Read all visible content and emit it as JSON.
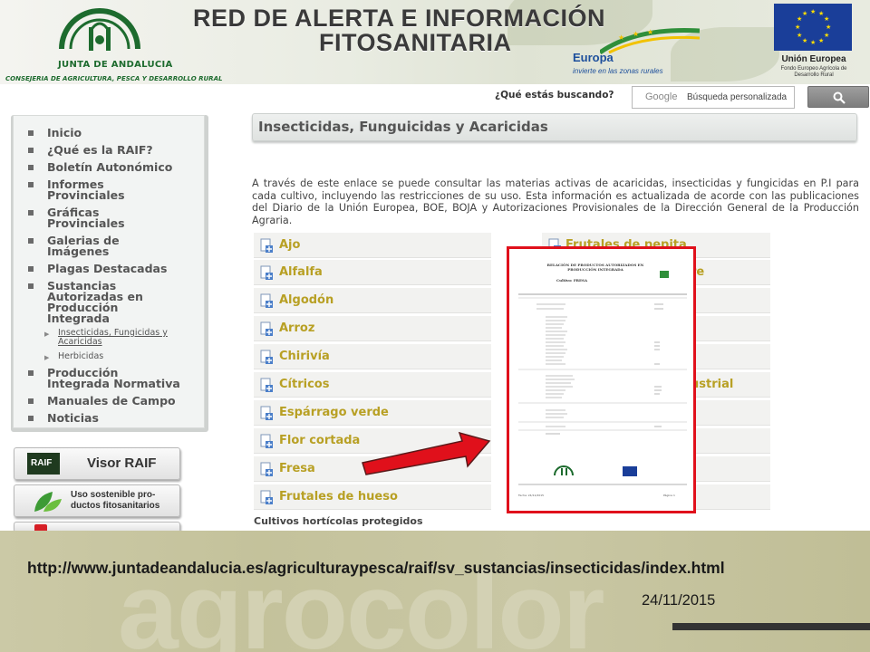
{
  "header": {
    "org_name": "JUNTA DE ANDALUCIA",
    "department": "CONSEJERIA DE AGRICULTURA, PESCA Y DESARROLLO RURAL",
    "title_line1": "RED DE ALERTA E INFORMACIÓN",
    "title_line2": "FITOSANITARIA",
    "europa_main": "Europa",
    "europa_slogan": "invierte en las zonas rurales",
    "eu_title": "Unión Europea",
    "eu_subtitle": "Fondo Europeo Agrícola de Desarrollo Rural"
  },
  "search": {
    "label": "¿Qué estás buscando?",
    "brand": "Google",
    "placeholder": "Búsqueda personalizada",
    "button_icon": "search-icon"
  },
  "sidebar": {
    "items": [
      {
        "label": "Inicio"
      },
      {
        "label": "¿Qué es la RAIF?"
      },
      {
        "label": "Boletín Autonómico"
      },
      {
        "label_1": "Informes",
        "label_2": "Provinciales"
      },
      {
        "label_1": "Gráficas",
        "label_2": "Provinciales"
      },
      {
        "label_1": "Galerias de",
        "label_2": "Imágenes"
      },
      {
        "label": "Plagas Destacadas"
      },
      {
        "label_1": "Sustancias",
        "label_2": "Autorizadas en",
        "label_3": "Producción",
        "label_4": "Integrada"
      },
      {
        "label_1": "Producción",
        "label_2": "Integrada Normativa"
      },
      {
        "label": "Manuales de Campo"
      },
      {
        "label": "Noticias"
      }
    ],
    "sub_items": [
      {
        "label_1": "Insecticidas, Fungicidas y",
        "label_2": "Acaricidas"
      },
      {
        "label": "Herbicidas"
      }
    ]
  },
  "banners": [
    {
      "label": "Visor RAIF",
      "badge": "RAIF"
    },
    {
      "label_1": "Uso sostenible pro-",
      "label_2": "ductos fitosanitarios"
    }
  ],
  "main": {
    "page_title": "Insecticidas, Funguicidas y Acaricidas",
    "intro": "A través de este enlace se puede consultar las materias activas de acaricidas, insecticidas y fungicidas en P.I para cada cultivo, incluyendo las restricciones de su uso. Esta información es actualizada de acorde con las publicaciones del Diario de la Unión Europea, BOE, BOJA y Autorizaciones Provisionales de la Dirección General de la Producción Agraria.",
    "crops_left": [
      "Ajo",
      "Alfalfa",
      "Algodón",
      "Arroz",
      "Chirivía",
      "Cítricos",
      "Espárrago verde",
      "Flor cortada",
      "Fresa",
      "Frutales de hueso"
    ],
    "crops_right_visible": [
      "Frutales de pepita",
      "re",
      "ustrial"
    ],
    "section_subhead": "Cultivos hortícolas protegidos"
  },
  "document_preview": {
    "title": "RELACIÓN DE PRODUCTOS AUTORIZADOS EN PRODUCCIÓN INTEGRADA",
    "crop": "Cultivo: FRESA",
    "footer_left": "Fecha: 24/11/2015",
    "footer_right": "Página 1"
  },
  "footer": {
    "watermark": "agrocolor",
    "url": "http://www.juntadeandalucia.es/agriculturaypesca/raif/sv_sustancias/insecticidas/index.html",
    "date": "24/11/2015"
  },
  "colors": {
    "link_gold": "#b8a024",
    "arrow_red": "#e0101b",
    "andalucia_green": "#1d6b2e",
    "eu_blue": "#1a3e99"
  }
}
